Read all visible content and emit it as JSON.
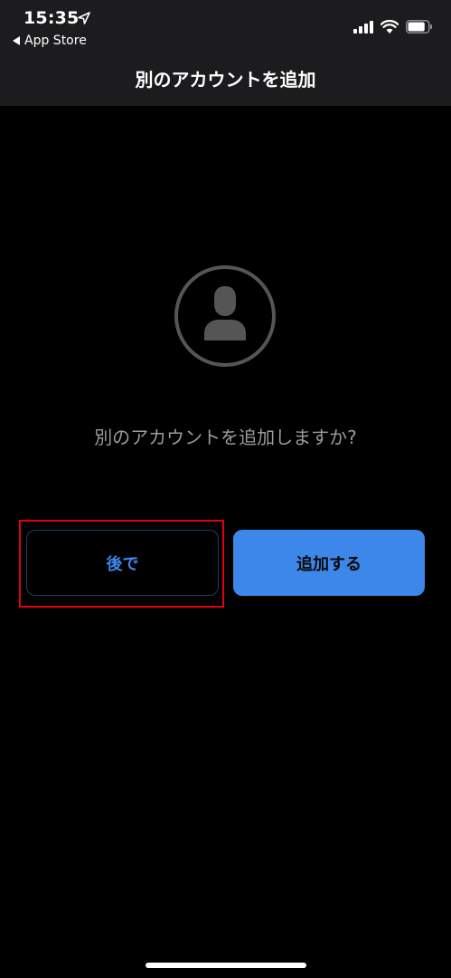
{
  "status_bar": {
    "time": "15:35",
    "back_app": "App Store",
    "battery_level": 0.85
  },
  "nav": {
    "title": "別のアカウントを追加"
  },
  "content": {
    "prompt": "別のアカウントを追加しますか?"
  },
  "actions": {
    "later_label": "後で",
    "add_label": "追加する"
  },
  "colors": {
    "background": "#000000",
    "nav_background": "#1c1c1e",
    "accent": "#3e87ea",
    "prompt_text": "#9b9b9f",
    "highlight": "#e3000b",
    "avatar": "#555555"
  },
  "icons": {
    "status_location": "location-arrow-icon",
    "status_back": "back-triangle-icon",
    "status_signal": "cellular-signal-icon",
    "status_wifi": "wifi-icon",
    "status_battery": "battery-icon",
    "avatar": "person-avatar-icon"
  }
}
